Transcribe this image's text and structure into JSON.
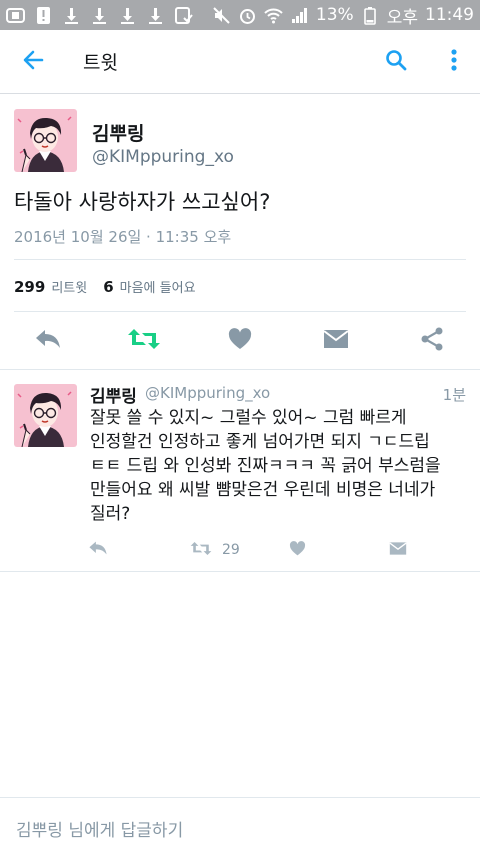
{
  "status_bar": {
    "battery_percent": "13%",
    "time_period": "오후",
    "time": "11:49",
    "left_icons": [
      "app-icon",
      "alert-icon",
      "download-icon",
      "download-icon",
      "download-icon",
      "download-icon",
      "checkbox-icon"
    ],
    "right_icons": [
      "mute-icon",
      "alarm-icon",
      "wifi-icon",
      "signal-icon",
      "battery-icon"
    ]
  },
  "app_bar": {
    "title": "트윗",
    "icons": [
      "back-arrow-icon",
      "search-icon",
      "more-vertical-icon"
    ],
    "accent_color": "#1da1f2"
  },
  "tweet": {
    "author_name": "김뿌링",
    "author_handle": "@KIMppuring_xo",
    "text": "타돌아 사랑하자가 쓰고싶어?",
    "timestamp": "2016년 10월 26일 · 11:35 오후",
    "retweet_count": "299",
    "retweet_label": "리트윗",
    "like_count": "6",
    "like_label": "마음에 들어요",
    "action_icons": [
      "reply-icon",
      "retweet-icon",
      "heart-icon",
      "message-icon",
      "share-icon"
    ],
    "retweet_color": "#19cf86"
  },
  "reply": {
    "author_name": "김뿌링",
    "author_handle": "@KIMppuring_xo",
    "time": "1분",
    "text": "잘못 쓸 수 있지~ 그럴수 있어~ 그럼 빠르게\n인정할건 인정하고 좋게 넘어가면 되지 ㄱㄷ드립\nㅌㅌ 드립 와 인성봐 진짜ㅋㅋㅋ 꼭 긁어 부스럼을\n만들어요 왜 씨발 뺨맞은건 우린데 비명은 너네가\n질러?",
    "retweet_count": "29"
  },
  "reply_bar": {
    "placeholder": "김뿌링 님에게 답글하기"
  }
}
